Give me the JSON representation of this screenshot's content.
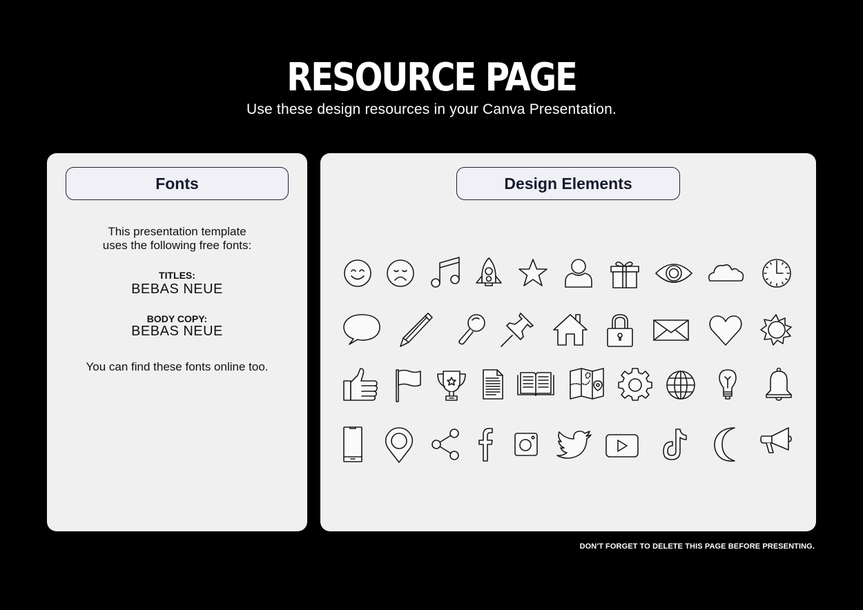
{
  "header": {
    "title": "RESOURCE PAGE",
    "subtitle": "Use these design resources in your Canva Presentation."
  },
  "fonts_panel": {
    "heading": "Fonts",
    "intro_line1": "This presentation template",
    "intro_line2": "uses the following free fonts:",
    "titles_label": "TITLES:",
    "titles_font": "BEBAS NEUE",
    "body_label": "BODY COPY:",
    "body_font": "BEBAS NEUE",
    "outro": "You can find these fonts online too."
  },
  "elements_panel": {
    "heading": "Design Elements",
    "icons": [
      [
        "smiley-face-icon",
        "sad-face-icon",
        "music-note-icon",
        "rocket-icon",
        "star-icon",
        "user-icon",
        "gift-icon",
        "eye-icon",
        "cloud-icon",
        "clock-icon"
      ],
      [
        "speech-bubble-icon",
        "pencil-icon",
        "magnifier-icon",
        "pushpin-icon",
        "house-icon",
        "padlock-icon",
        "envelope-icon",
        "heart-icon",
        "sun-icon"
      ],
      [
        "thumbs-up-icon",
        "flag-icon",
        "trophy-icon",
        "document-icon",
        "open-book-icon",
        "map-icon",
        "gear-icon",
        "globe-icon",
        "lightbulb-icon",
        "bell-icon"
      ],
      [
        "smartphone-icon",
        "location-pin-icon",
        "share-icon",
        "facebook-icon",
        "instagram-icon",
        "twitter-icon",
        "youtube-icon",
        "tiktok-icon",
        "moon-icon",
        "megaphone-icon"
      ]
    ]
  },
  "footer": {
    "note": "DON'T FORGET TO DELETE THIS PAGE BEFORE PRESENTING."
  }
}
